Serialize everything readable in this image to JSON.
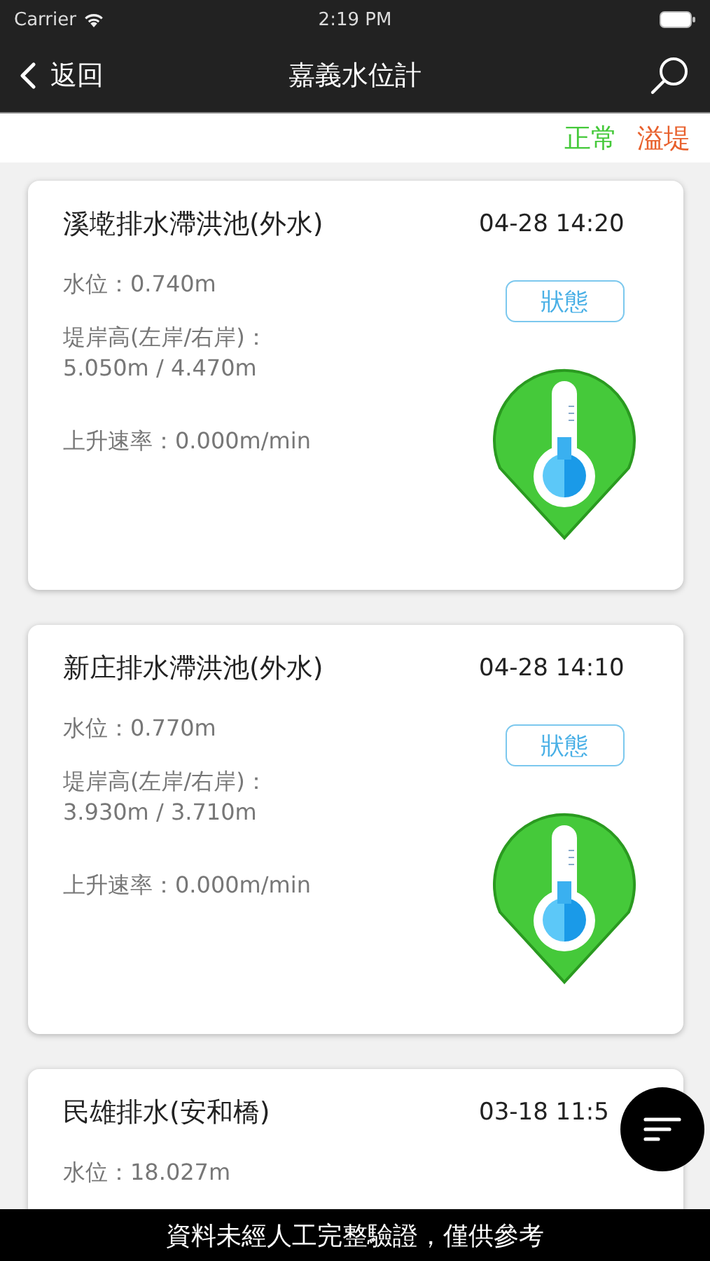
{
  "status_bar": {
    "carrier": "Carrier",
    "time": "2:19 PM"
  },
  "nav": {
    "back": "返回",
    "title": "嘉義水位計"
  },
  "legend": [
    {
      "label": "正常",
      "color": "#45c93a"
    },
    {
      "label": "溢堤",
      "color": "#e8602c"
    }
  ],
  "stations": [
    {
      "name": "溪墘排水滯洪池(外水)",
      "time": "04-28 14:20",
      "level": "水位：0.740m",
      "bank": [
        "堤岸高(左岸/右岸)：",
        "5.050m / 4.470m"
      ],
      "rate": "上升速率：0.000m/min",
      "status_button": "狀態",
      "color": "#45c93a"
    },
    {
      "name": "新庄排水滯洪池(外水)",
      "time": "04-28 14:10",
      "level": "水位：0.770m",
      "bank": [
        "堤岸高(左岸/右岸)：",
        "3.930m / 3.710m"
      ],
      "rate": "上升速率：0.000m/min",
      "status_button": "狀態",
      "color": "#45c93a"
    },
    {
      "name": "民雄排水(安和橋)",
      "time": "03-18 11:5",
      "level": "水位：18.027m"
    }
  ],
  "footer": "資料未經人工完整驗證，僅供參考"
}
